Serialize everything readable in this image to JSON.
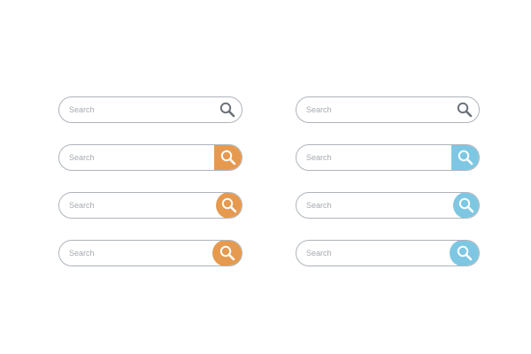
{
  "colors": {
    "border": "#aeb4bb",
    "placeholder_text": "#a6aab0",
    "icon_dark": "#6b7179",
    "orange": "#e59a4f",
    "blue": "#7ec7e2",
    "icon_on_accent": "#ffffff"
  },
  "left_column": [
    {
      "placeholder": "Search",
      "button_style": "plain",
      "accent": "none",
      "icon": "search-icon"
    },
    {
      "placeholder": "Search",
      "button_style": "square",
      "accent": "orange",
      "icon": "search-icon"
    },
    {
      "placeholder": "Search",
      "button_style": "circle",
      "accent": "orange",
      "icon": "search-icon"
    },
    {
      "placeholder": "Search",
      "button_style": "pill",
      "accent": "orange",
      "icon": "search-icon"
    }
  ],
  "right_column": [
    {
      "placeholder": "Search",
      "button_style": "plain",
      "accent": "none",
      "icon": "search-icon"
    },
    {
      "placeholder": "Search",
      "button_style": "square",
      "accent": "blue",
      "icon": "search-icon"
    },
    {
      "placeholder": "Search",
      "button_style": "circle",
      "accent": "blue",
      "icon": "search-icon"
    },
    {
      "placeholder": "Search",
      "button_style": "pill",
      "accent": "blue",
      "icon": "search-icon"
    }
  ]
}
